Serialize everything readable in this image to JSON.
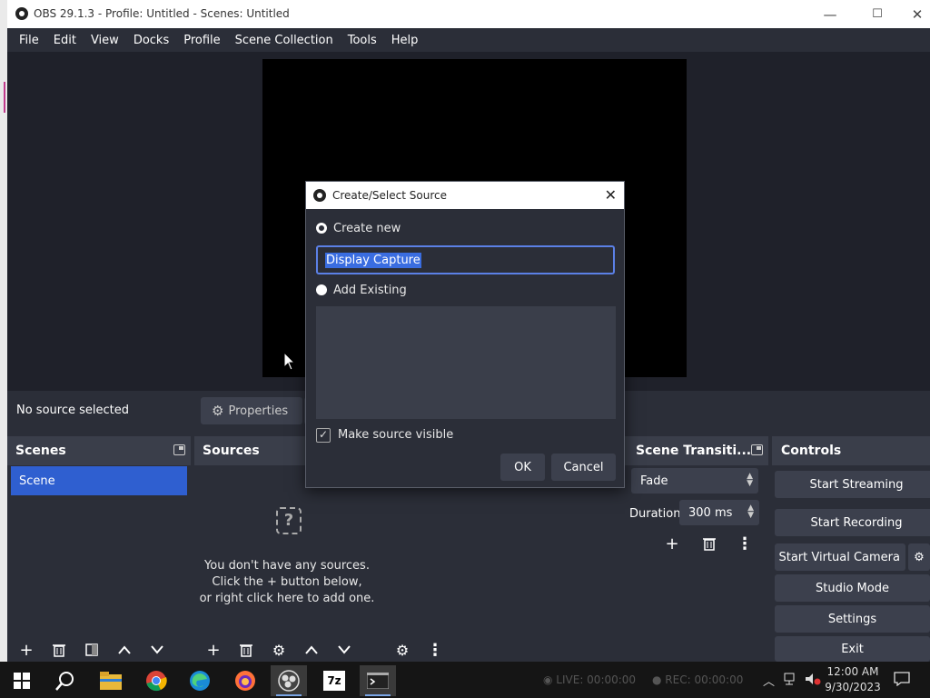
{
  "window": {
    "title": "OBS 29.1.3 - Profile: Untitled - Scenes: Untitled",
    "minimize": "—",
    "maximize": "☐",
    "close": "✕"
  },
  "menu": [
    "File",
    "Edit",
    "View",
    "Docks",
    "Profile",
    "Scene Collection",
    "Tools",
    "Help"
  ],
  "source_bar": {
    "status": "No source selected",
    "properties_label": "Properties"
  },
  "scenes": {
    "title": "Scenes",
    "items": [
      "Scene"
    ]
  },
  "sources": {
    "title": "Sources",
    "empty_line1": "You don't have any sources.",
    "empty_line2": "Click the + button below,",
    "empty_line3": "or right click here to add one."
  },
  "transitions": {
    "title": "Scene Transiti...",
    "selected": "Fade",
    "duration_label": "Duration",
    "duration_value": "300 ms"
  },
  "controls": {
    "title": "Controls",
    "start_streaming": "Start Streaming",
    "start_recording": "Start Recording",
    "start_virtual_camera": "Start Virtual Camera",
    "studio_mode": "Studio Mode",
    "settings": "Settings",
    "exit": "Exit"
  },
  "dialog": {
    "title": "Create/Select Source",
    "create_new_label": "Create new",
    "name_value": "Display Capture",
    "add_existing_label": "Add Existing",
    "make_visible_label": "Make source visible",
    "ok": "OK",
    "cancel": "Cancel"
  },
  "taskbar": {
    "live": "LIVE: 00:00:00",
    "rec": "REC: 00:00:00",
    "time": "12:00 AM",
    "date": "9/30/2023"
  },
  "colors": {
    "accent": "#2f5fd0",
    "background": "#2b2e38",
    "dock_header": "#3a3e4a",
    "button": "#3c404d"
  }
}
